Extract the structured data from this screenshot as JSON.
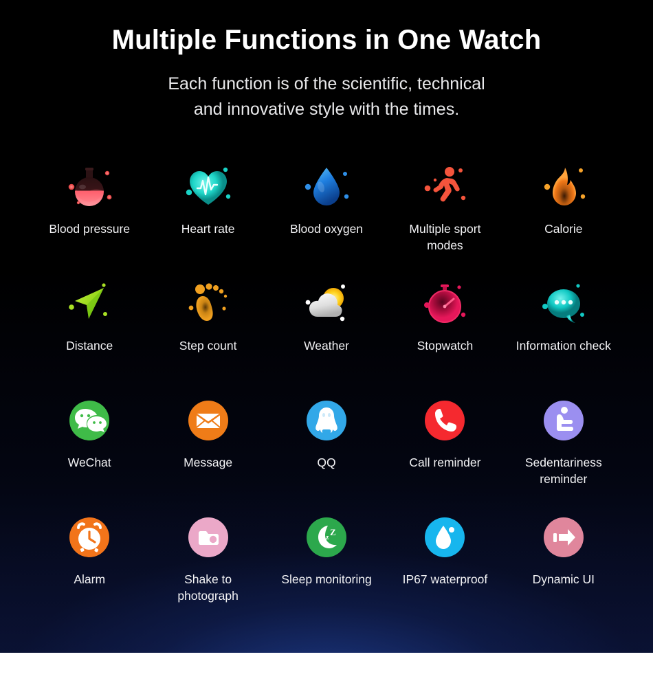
{
  "header": {
    "title": "Multiple Functions in One Watch",
    "subtitle_line1": "Each function is of the scientific, technical",
    "subtitle_line2": "and innovative style with the times."
  },
  "colors": {
    "panel_background": "#000000",
    "page_background": "#ffffff",
    "bottom_glow": "#1e3c8c",
    "title_text": "#ffffff",
    "subtitle_text": "#e8e8ea",
    "label_text": "#f2f2f4",
    "blood_pressure": "#ff5f6d",
    "heart_rate": "#1fd6c8",
    "blood_oxygen": "#1f7fe0",
    "sport": "#f4543c",
    "calorie": "#f07818",
    "distance": "#9ed82a",
    "step_count": "#f0a020",
    "weather_cloud": "#e8e8e8",
    "weather_sun": "#ffd21e",
    "stopwatch": "#d6134f",
    "information": "#12c9c4",
    "wechat": "#3fbb48",
    "message": "#ef7c18",
    "qq": "#32a8e8",
    "call": "#f5292f",
    "sedentariness": "#9b8ff0",
    "alarm": "#f2741a",
    "shake": "#eba8c8",
    "sleep": "#2ca84c",
    "waterproof": "#17b6ee",
    "dynamic_ui": "#e0869c"
  },
  "grid": {
    "rows": [
      {
        "cells": [
          {
            "label": "Blood pressure",
            "icon": "flask-icon"
          },
          {
            "label": "Heart rate",
            "icon": "heart-pulse-icon"
          },
          {
            "label": "Blood oxygen",
            "icon": "water-drop-icon"
          },
          {
            "label": "Multiple sport modes",
            "icon": "running-person-icon"
          },
          {
            "label": "Calorie",
            "icon": "flame-icon"
          }
        ]
      },
      {
        "cells": [
          {
            "label": "Distance",
            "icon": "navigation-arrow-icon"
          },
          {
            "label": "Step count",
            "icon": "footprint-icon"
          },
          {
            "label": "Weather",
            "icon": "cloud-sun-icon"
          },
          {
            "label": "Stopwatch",
            "icon": "stopwatch-icon"
          },
          {
            "label": "Information check",
            "icon": "speech-bubble-icon"
          }
        ]
      },
      {
        "cells": [
          {
            "label": "WeChat",
            "icon": "wechat-icon"
          },
          {
            "label": "Message",
            "icon": "envelope-icon"
          },
          {
            "label": "QQ",
            "icon": "qq-penguin-icon"
          },
          {
            "label": "Call reminder",
            "icon": "phone-handset-icon"
          },
          {
            "label": "Sedentariness reminder",
            "icon": "sitting-person-icon"
          }
        ]
      },
      {
        "cells": [
          {
            "label": "Alarm",
            "icon": "alarm-clock-icon"
          },
          {
            "label": "Shake to photograph",
            "icon": "camera-icon"
          },
          {
            "label": "Sleep monitoring",
            "icon": "moon-zzz-icon"
          },
          {
            "label": "IP67 waterproof",
            "icon": "waterdrop-solid-icon"
          },
          {
            "label": "Dynamic UI",
            "icon": "arrow-right-icon"
          }
        ]
      }
    ]
  },
  "sleep_icon_text": {
    "z_small": "z",
    "z_large": "Z"
  }
}
